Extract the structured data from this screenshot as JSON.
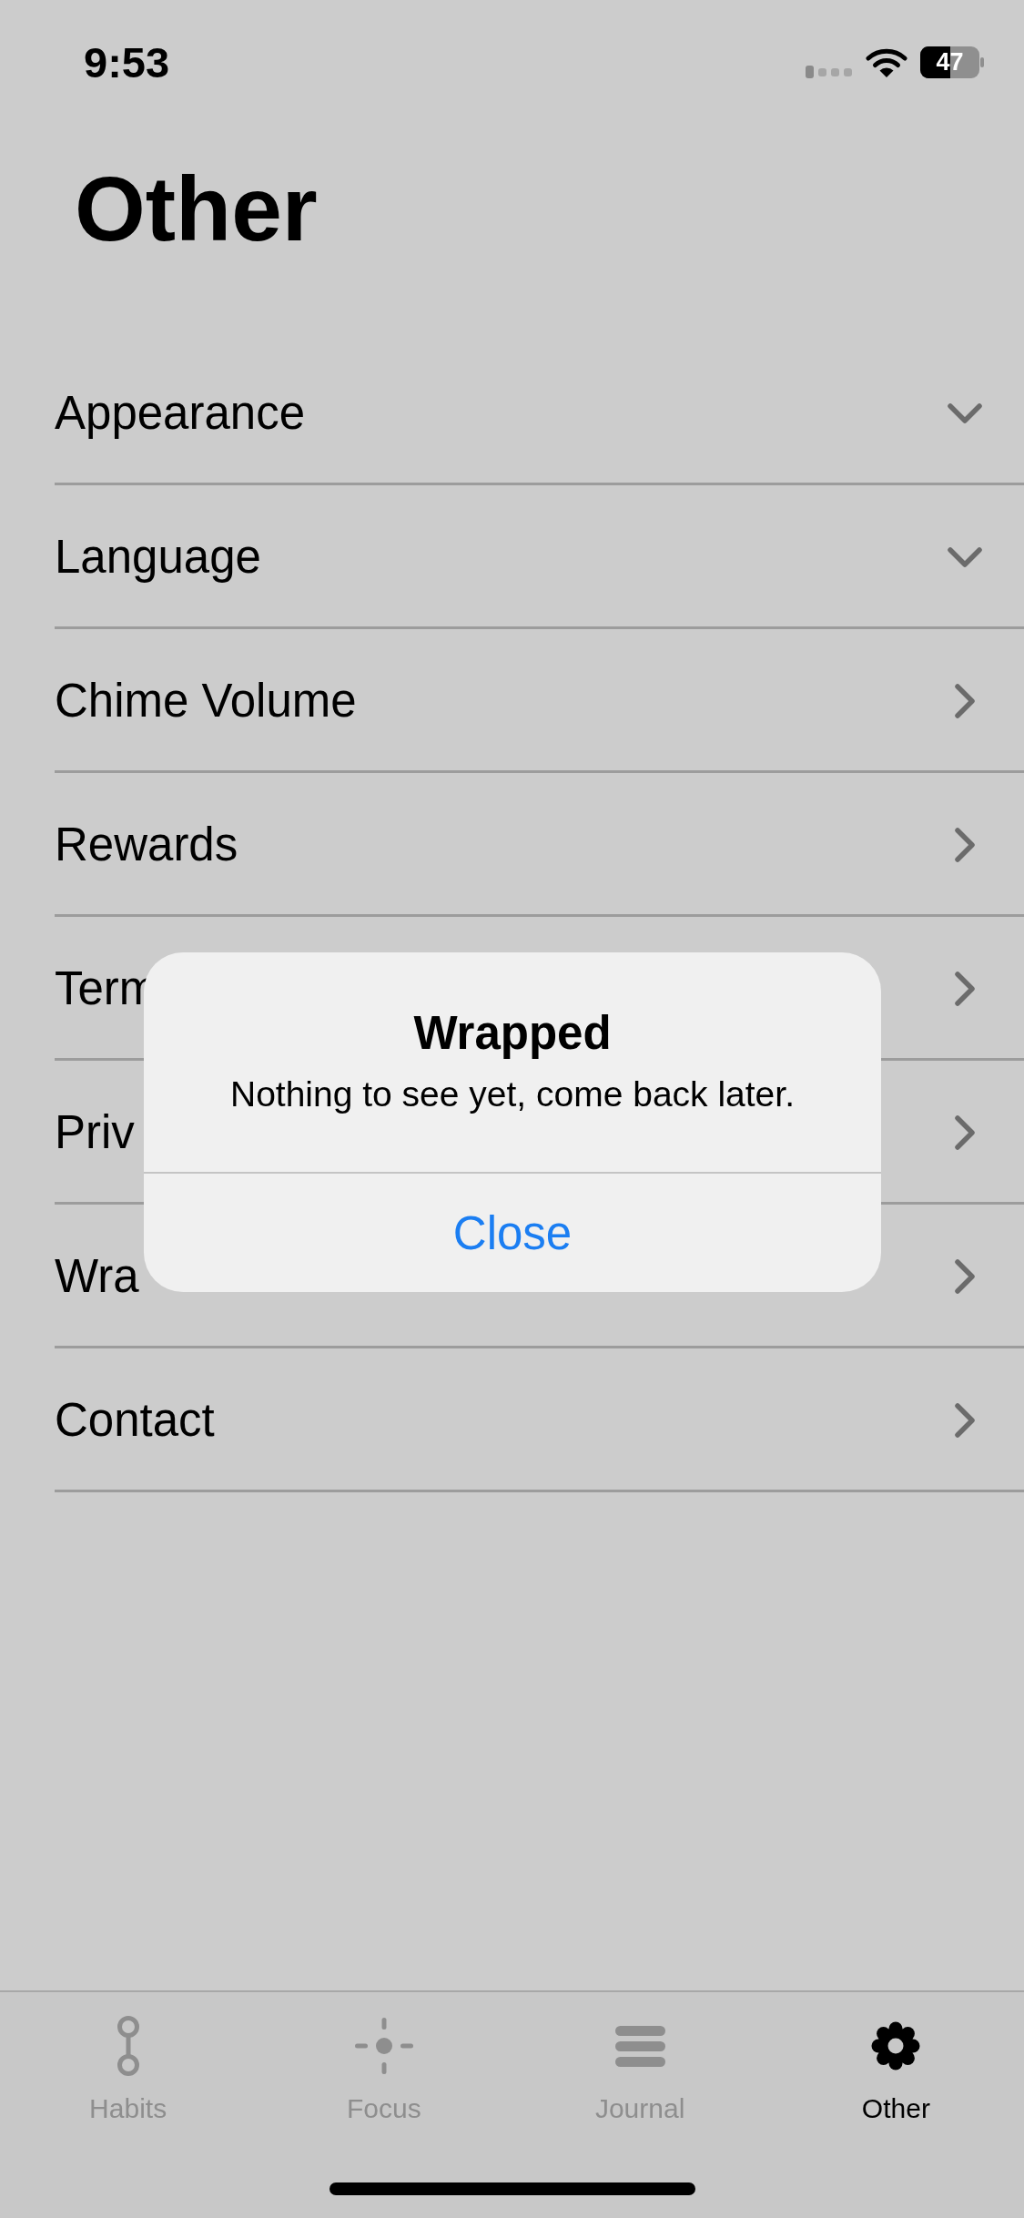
{
  "status_bar": {
    "time": "9:53",
    "battery": "47"
  },
  "header": {
    "title": "Other"
  },
  "rows": [
    {
      "label": "Appearance",
      "kind": "dropdown"
    },
    {
      "label": "Language",
      "kind": "dropdown"
    },
    {
      "label": "Chime Volume",
      "kind": "link"
    },
    {
      "label": "Rewards",
      "kind": "link"
    },
    {
      "label": "Term",
      "kind": "link"
    },
    {
      "label": "Priv",
      "kind": "link"
    },
    {
      "label": "Wra",
      "kind": "link"
    },
    {
      "label": "Contact",
      "kind": "link"
    }
  ],
  "alert": {
    "title": "Wrapped",
    "message": "Nothing to see yet, come back later.",
    "buttons": [
      "Close"
    ]
  },
  "tab_bar": {
    "tabs": [
      {
        "label": "Habits",
        "kind": "habits",
        "selected": false
      },
      {
        "label": "Focus",
        "kind": "focus",
        "selected": false
      },
      {
        "label": "Journal",
        "kind": "journal",
        "selected": false
      },
      {
        "label": "Other",
        "kind": "settings",
        "selected": true
      }
    ]
  }
}
